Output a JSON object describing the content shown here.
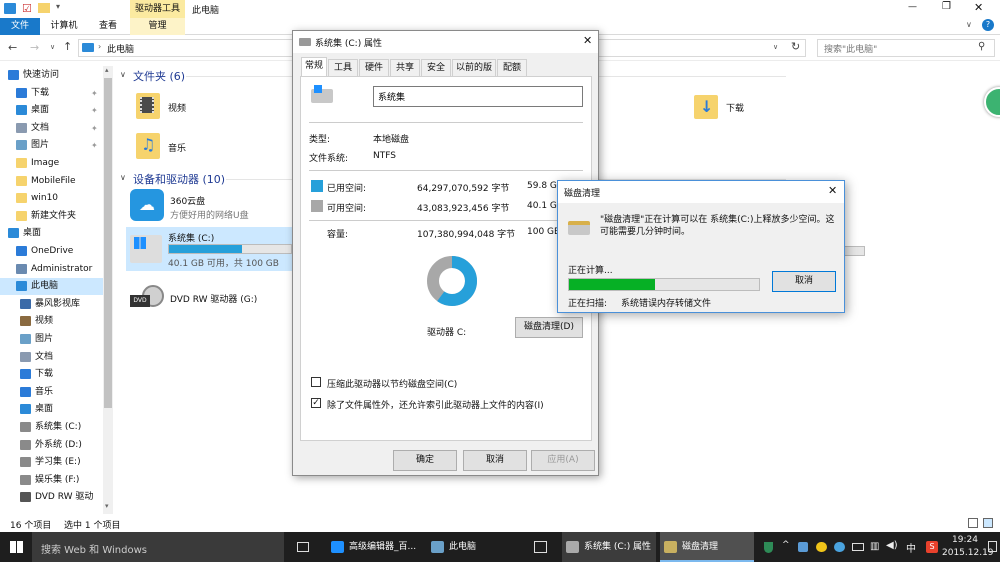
{
  "window": {
    "title": "此电脑",
    "ribbon_context": "驱动器工具",
    "controls": [
      "—",
      "❐",
      "✕"
    ]
  },
  "ribbon": {
    "tabs": [
      "文件",
      "计算机",
      "查看",
      "管理"
    ],
    "help": "?"
  },
  "address": {
    "path": "此电脑",
    "search_placeholder": "搜索\"此电脑\""
  },
  "nav": {
    "items": [
      {
        "label": "快速访问",
        "level": 0,
        "icon": "star-icon",
        "color": "#2b7bd8"
      },
      {
        "label": "下载",
        "level": 1,
        "icon": "download-icon",
        "color": "#2b7bd8",
        "pin": true
      },
      {
        "label": "桌面",
        "level": 1,
        "icon": "desktop-icon",
        "color": "#2b8ad8",
        "pin": true
      },
      {
        "label": "文档",
        "level": 1,
        "icon": "document-icon",
        "color": "#8a9ab0",
        "pin": true
      },
      {
        "label": "图片",
        "level": 1,
        "icon": "picture-icon",
        "color": "#6aa0c8",
        "pin": true
      },
      {
        "label": "Image",
        "level": 1,
        "icon": "folder-icon",
        "color": "#f6d36d"
      },
      {
        "label": "MobileFile",
        "level": 1,
        "icon": "folder-icon",
        "color": "#f6d36d"
      },
      {
        "label": "win10",
        "level": 1,
        "icon": "folder-icon",
        "color": "#f6d36d"
      },
      {
        "label": "新建文件夹",
        "level": 1,
        "icon": "folder-icon",
        "color": "#f6d36d"
      },
      {
        "label": "桌面",
        "level": 0,
        "icon": "desktop-icon",
        "color": "#2b8ad8"
      },
      {
        "label": "OneDrive",
        "level": 1,
        "icon": "cloud-icon",
        "color": "#2b7bd8"
      },
      {
        "label": "Administrator",
        "level": 1,
        "icon": "user-icon",
        "color": "#6a8ab0"
      },
      {
        "label": "此电脑",
        "level": 1,
        "icon": "computer-icon",
        "color": "#2b8ad8",
        "selected": true
      },
      {
        "label": "暴风影视库",
        "level": 2,
        "icon": "video-library-icon",
        "color": "#3a6aa8"
      },
      {
        "label": "视频",
        "level": 2,
        "icon": "video-icon",
        "color": "#8a6a40"
      },
      {
        "label": "图片",
        "level": 2,
        "icon": "picture-icon",
        "color": "#6aa0c8"
      },
      {
        "label": "文档",
        "level": 2,
        "icon": "document-icon",
        "color": "#8a9ab0"
      },
      {
        "label": "下载",
        "level": 2,
        "icon": "download-icon",
        "color": "#2b7bd8"
      },
      {
        "label": "音乐",
        "level": 2,
        "icon": "music-icon",
        "color": "#2b7bd8"
      },
      {
        "label": "桌面",
        "level": 2,
        "icon": "desktop-icon",
        "color": "#2b8ad8"
      },
      {
        "label": "系统集 (C:)",
        "level": 2,
        "icon": "drive-icon",
        "color": "#8a8a8a"
      },
      {
        "label": "外系统 (D:)",
        "level": 2,
        "icon": "drive-icon",
        "color": "#8a8a8a"
      },
      {
        "label": "学习集 (E:)",
        "level": 2,
        "icon": "drive-icon",
        "color": "#8a8a8a"
      },
      {
        "label": "娱乐集 (F:)",
        "level": 2,
        "icon": "drive-icon",
        "color": "#8a8a8a"
      },
      {
        "label": "DVD RW 驱动",
        "level": 2,
        "icon": "dvd-icon",
        "color": "#555555"
      }
    ]
  },
  "content": {
    "folders_header": "文件夹 (6)",
    "folders": [
      "视频",
      "下载",
      "音乐"
    ],
    "devices_header": "设备和驱动器 (10)",
    "cloud": {
      "name": "360云盘",
      "desc": "方便好用的网络U盘"
    },
    "drive_c": {
      "name": "系统集 (C:)",
      "detail": "40.1 GB 可用，共 100 GB",
      "used_fraction": 0.6
    },
    "dvd": {
      "name": "DVD RW 驱动器 (G:)"
    }
  },
  "status": {
    "count": "16 个项目",
    "selected": "选中 1 个项目"
  },
  "props_dialog": {
    "title": "系统集 (C:) 属性",
    "tabs": [
      "常规",
      "工具",
      "硬件",
      "共享",
      "安全",
      "以前的版本",
      "配额"
    ],
    "name_value": "系统集",
    "type_label": "类型:",
    "type_value": "本地磁盘",
    "fs_label": "文件系统:",
    "fs_value": "NTFS",
    "used_label": "已用空间:",
    "used_bytes": "64,297,070,592 字节",
    "used_gb": "59.8 GB",
    "free_label": "可用空间:",
    "free_bytes": "43,083,923,456 字节",
    "free_gb": "40.1 GB",
    "cap_label": "容量:",
    "cap_bytes": "107,380,994,048 字节",
    "cap_gb": "100 GB",
    "used_fraction": 0.6,
    "drive_label": "驱动器 C:",
    "cleanup_button": "磁盘清理(D)",
    "compress_label": "压缩此驱动器以节约磁盘空间(C)",
    "index_label": "除了文件属性外，还允许索引此驱动器上文件的内容(I)",
    "ok": "确定",
    "cancel": "取消",
    "apply": "应用(A)",
    "colors": {
      "used": "#26a0da",
      "free": "#a8a8a8"
    }
  },
  "cleanup_dialog": {
    "title": "磁盘清理",
    "message": "\"磁盘清理\"正在计算可以在 系统集(C:)上释放多少空间。这可能需要几分钟时间。",
    "calc_label": "正在计算...",
    "progress": 0.45,
    "cancel": "取消",
    "scan_label": "正在扫描:",
    "scan_value": "系统错误内存转储文件",
    "progress_color": "#06b025"
  },
  "taskbar": {
    "search": "搜索 Web 和 Windows",
    "items": [
      "高级编辑器_百...",
      "此电脑",
      "系统集 (C:) 属性",
      "磁盘清理"
    ],
    "tray": [
      "中"
    ],
    "time": "19:24",
    "date": "2015.12.19"
  }
}
